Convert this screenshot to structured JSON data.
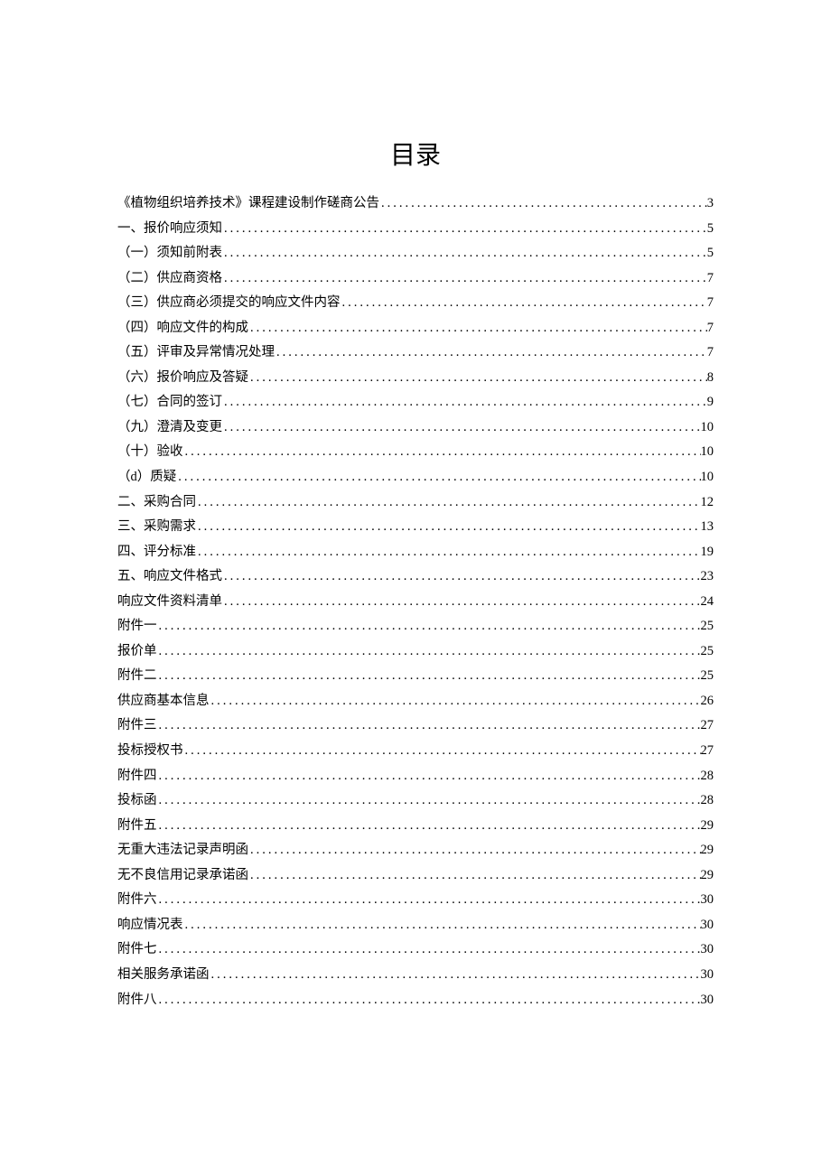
{
  "title": "目录",
  "entries": [
    {
      "label": "《植物组织培养技术》课程建设制作磋商公告",
      "page": "3"
    },
    {
      "label": "一、报价响应须知",
      "page": "5"
    },
    {
      "label": "（一）须知前附表",
      "page": "5"
    },
    {
      "label": "（二）供应商资格",
      "page": "7"
    },
    {
      "label": "（三）供应商必须提交的响应文件内容",
      "page": "7"
    },
    {
      "label": "（四）响应文件的构成",
      "page": "7"
    },
    {
      "label": "（五）评审及异常情况处理",
      "page": "7"
    },
    {
      "label": "（六）报价响应及答疑",
      "page": "8"
    },
    {
      "label": "（七）合同的签订",
      "page": "9"
    },
    {
      "label": "（九）澄清及变更",
      "page": "10"
    },
    {
      "label": "（十）验收",
      "page": "10"
    },
    {
      "label": "（d）质疑",
      "page": "10"
    },
    {
      "label": "二、采购合同",
      "page": "12"
    },
    {
      "label": "三、采购需求",
      "page": "13"
    },
    {
      "label": "四、评分标准",
      "page": "19"
    },
    {
      "label": "五、响应文件格式",
      "page": "23"
    },
    {
      "label": "响应文件资料清单",
      "page": "24"
    },
    {
      "label": "附件一",
      "page": "25"
    },
    {
      "label": "报价单",
      "page": "25"
    },
    {
      "label": "附件二",
      "page": "25"
    },
    {
      "label": "供应商基本信息",
      "page": "26"
    },
    {
      "label": "附件三",
      "page": "27"
    },
    {
      "label": "投标授权书",
      "page": "27"
    },
    {
      "label": "附件四",
      "page": "28"
    },
    {
      "label": "投标函",
      "page": "28"
    },
    {
      "label": "附件五",
      "page": "29"
    },
    {
      "label": "无重大违法记录声明函",
      "page": "29"
    },
    {
      "label": "无不良信用记录承诺函",
      "page": "29"
    },
    {
      "label": "附件六",
      "page": "30"
    },
    {
      "label": "响应情况表",
      "page": "30"
    },
    {
      "label": "附件七",
      "page": "30"
    },
    {
      "label": "相关服务承诺函",
      "page": "30"
    },
    {
      "label": "附件八",
      "page": "30"
    }
  ]
}
